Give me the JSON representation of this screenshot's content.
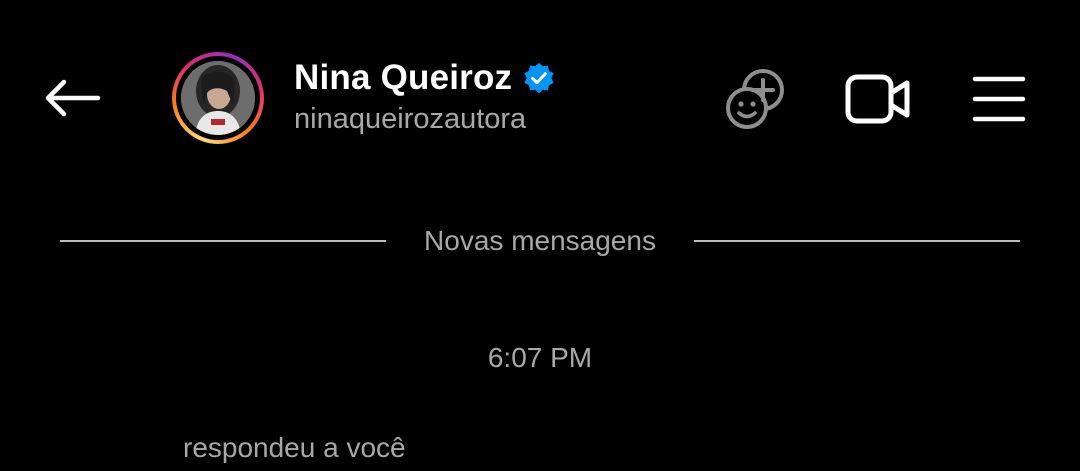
{
  "header": {
    "profile_name": "Nina Queiroz",
    "username": "ninaqueirozautora",
    "verified": true,
    "icons": {
      "back": "arrow-left-icon",
      "stickers": "stickers-add-icon",
      "video": "video-camera-icon",
      "menu": "hamburger-menu-icon",
      "verified": "verified-badge-icon"
    }
  },
  "thread": {
    "divider_label": "Novas mensagens",
    "timestamp": "6:07 PM",
    "reply_note": "respondeu a você"
  },
  "colors": {
    "background": "#000000",
    "primary_text": "#ffffff",
    "secondary_text": "#a8a8a8",
    "verified_blue": "#0095f6"
  }
}
